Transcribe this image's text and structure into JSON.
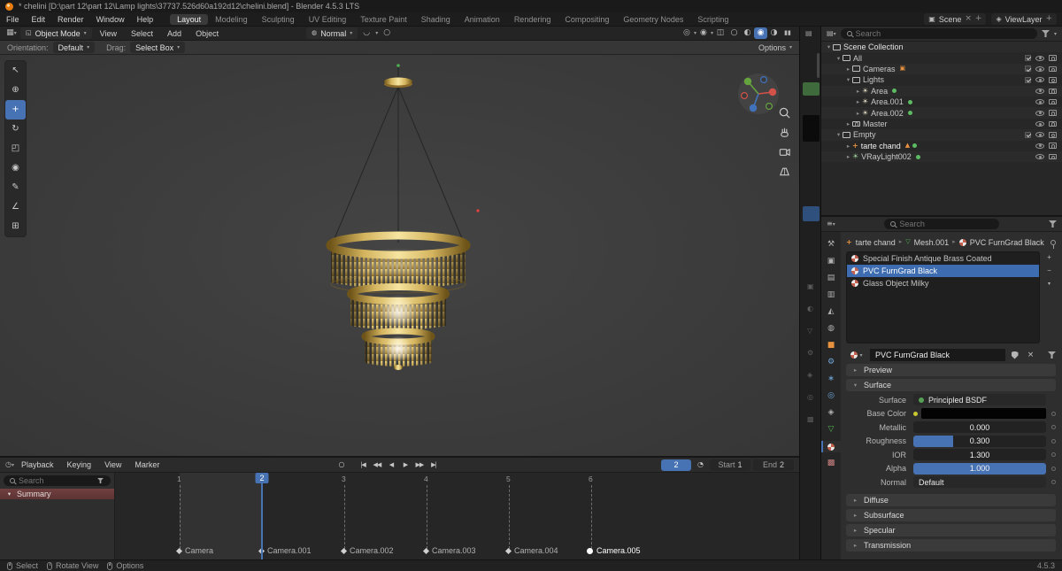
{
  "titlebar": {
    "title": "* chelini [D:\\part 12\\part 12\\Lamp lights\\37737.526d60a192d12\\chelini.blend] - Blender 4.5.3 LTS"
  },
  "topbar": {
    "menus": [
      "File",
      "Edit",
      "Render",
      "Window",
      "Help"
    ],
    "workspaces": [
      "Layout",
      "Modeling",
      "Sculpting",
      "UV Editing",
      "Texture Paint",
      "Shading",
      "Animation",
      "Rendering",
      "Compositing",
      "Geometry Nodes",
      "Scripting"
    ],
    "scene": "Scene",
    "viewlayer": "ViewLayer"
  },
  "viewport": {
    "header": {
      "mode": "Object Mode",
      "menus": [
        "View",
        "Select",
        "Add",
        "Object"
      ],
      "orientation": "Normal"
    },
    "settings": {
      "orientation_label": "Orientation:",
      "orientation_value": "Default",
      "drag_label": "Drag:",
      "drag_value": "Select Box",
      "options": "Options"
    }
  },
  "outliner": {
    "search_placeholder": "Search",
    "rows": [
      {
        "arrow": "▾",
        "label": "Scene Collection"
      },
      {
        "arrow": "▾",
        "label": "All"
      },
      {
        "arrow": "▸",
        "label": "Cameras"
      },
      {
        "arrow": "▾",
        "label": "Lights"
      },
      {
        "arrow": "▸",
        "label": "Area"
      },
      {
        "arrow": "▸",
        "label": "Area.001"
      },
      {
        "arrow": "▸",
        "label": "Area.002"
      },
      {
        "arrow": "▸",
        "label": "Master"
      },
      {
        "arrow": "▾",
        "label": "Empty"
      },
      {
        "arrow": "▸",
        "label": "tarte chand"
      },
      {
        "arrow": "▸",
        "label": "VRayLight002"
      }
    ]
  },
  "properties": {
    "search_placeholder": "Search",
    "breadcrumb": [
      "tarte chand",
      "Mesh.001",
      "PVC FurnGrad Black"
    ],
    "slots": [
      "Special Finish Antique Brass Coated",
      "PVC FurnGrad Black",
      "Glass Object Milky"
    ],
    "material_name": "PVC FurnGrad Black",
    "panels": {
      "preview": "Preview",
      "surface": "Surface",
      "diffuse": "Diffuse",
      "subsurface": "Subsurface",
      "specular": "Specular",
      "transmission": "Transmission"
    },
    "fields": {
      "surface_label": "Surface",
      "surface_value": "Principled BSDF",
      "base_color_label": "Base Color",
      "metallic_label": "Metallic",
      "metallic_value": "0.000",
      "roughness_label": "Roughness",
      "roughness_value": "0.300",
      "ior_label": "IOR",
      "ior_value": "1.300",
      "alpha_label": "Alpha",
      "alpha_value": "1.000",
      "normal_label": "Normal",
      "normal_value": "Default"
    }
  },
  "timeline": {
    "menus": [
      "Playback",
      "Keying",
      "View",
      "Marker"
    ],
    "search_placeholder": "Search",
    "summary": "Summary",
    "frames": [
      "1",
      "2",
      "3",
      "4",
      "5",
      "6"
    ],
    "markers": [
      "Camera",
      "Camera.001",
      "Camera.002",
      "Camera.003",
      "Camera.004",
      "Camera.005"
    ],
    "current_frame": "2",
    "start_label": "Start",
    "start_value": "1",
    "end_label": "End",
    "end_value": "2"
  },
  "statusbar": {
    "items": [
      "Select",
      "Rotate View",
      "Options"
    ],
    "version": "4.5.3"
  }
}
